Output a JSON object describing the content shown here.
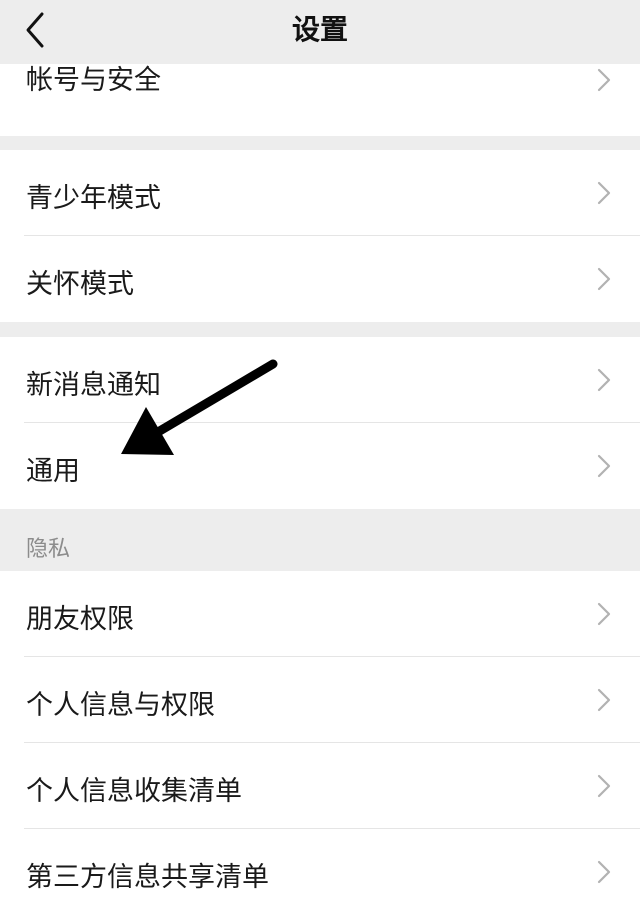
{
  "header": {
    "title": "设置",
    "back_icon": "chevron-left-icon"
  },
  "groups": [
    {
      "items": [
        {
          "label": "帐号与安全"
        }
      ]
    },
    {
      "items": [
        {
          "label": "青少年模式"
        },
        {
          "label": "关怀模式"
        }
      ]
    },
    {
      "items": [
        {
          "label": "新消息通知"
        },
        {
          "label": "通用"
        }
      ]
    },
    {
      "section_title": "隐私",
      "items": [
        {
          "label": "朋友权限"
        },
        {
          "label": "个人信息与权限"
        },
        {
          "label": "个人信息收集清单"
        },
        {
          "label": "第三方信息共享清单"
        }
      ]
    }
  ],
  "annotation": {
    "arrow_target": "通用",
    "arrow_color": "#000000"
  },
  "colors": {
    "background": "#ededed",
    "row_background": "#ffffff",
    "chevron": "#b2b2b2",
    "divider": "#e5e5e5",
    "section_text": "#8c8c8c"
  }
}
